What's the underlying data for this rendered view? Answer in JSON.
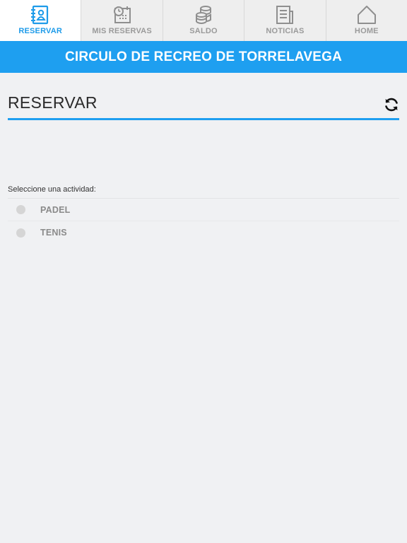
{
  "tabs": [
    {
      "id": "reservar",
      "label": "RESERVAR",
      "icon": "address-book-icon",
      "active": true
    },
    {
      "id": "mis-reservas",
      "label": "MIS RESERVAS",
      "icon": "calendar-clock-icon",
      "active": false
    },
    {
      "id": "saldo",
      "label": "SALDO",
      "icon": "coins-icon",
      "active": false
    },
    {
      "id": "noticias",
      "label": "NOTICIAS",
      "icon": "newspaper-icon",
      "active": false
    },
    {
      "id": "home",
      "label": "HOME",
      "icon": "home-icon",
      "active": false
    }
  ],
  "header": {
    "club_title": "CIRCULO DE RECREO DE TORRELAVEGA"
  },
  "section": {
    "title": "RESERVAR",
    "refresh_icon": "refresh-icon"
  },
  "activity": {
    "prompt": "Seleccione una actividad:",
    "options": [
      {
        "label": "PADEL",
        "selected": false
      },
      {
        "label": "TENIS",
        "selected": false
      }
    ]
  },
  "colors": {
    "accent": "#1e9ff0",
    "active_tab_text": "#1e9be9",
    "inactive_tab_text": "#9a9a9a",
    "background": "#f0f1f3"
  }
}
